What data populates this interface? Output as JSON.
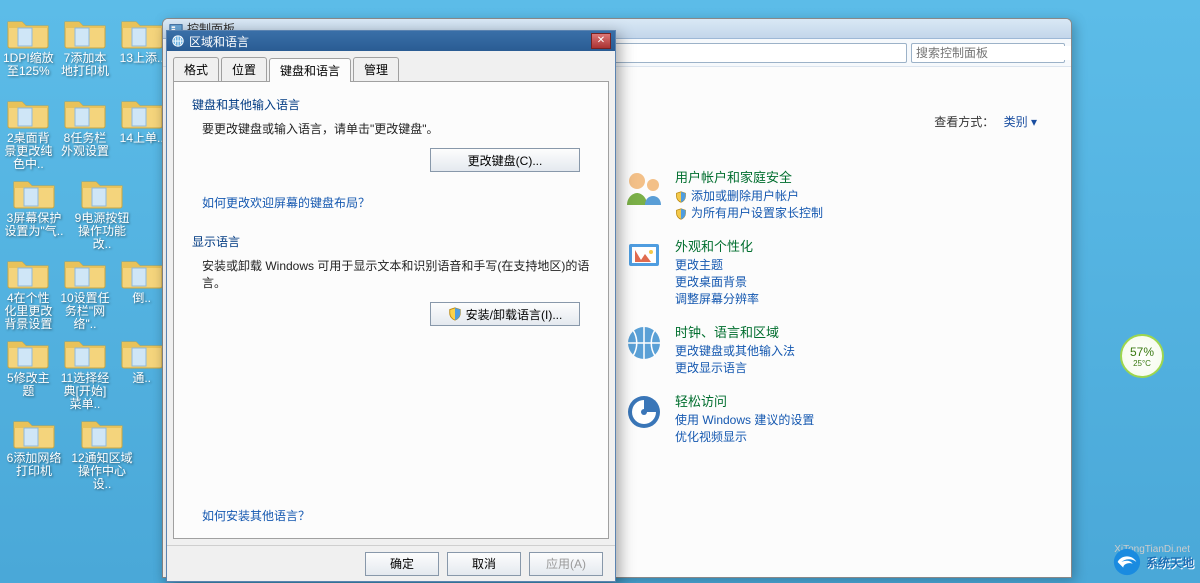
{
  "desktop_icons": [
    [
      "1DPI缩放至125%",
      "7添加本地打印机",
      "13上添.."
    ],
    [
      "2桌面背景更改纯色中..",
      "8任务栏外观设置",
      "14上单.."
    ],
    [
      "3屏幕保护设置为\"气..",
      "9电源按钮操作功能改.."
    ],
    [
      "4在个性化里更改背景设置",
      "10设置任务栏\"网络\"..",
      "倒.."
    ],
    [
      "5修改主题",
      "11选择经典[开始]菜单..",
      "通.."
    ],
    [
      "6添加网络打印机",
      "12通知区域操作中心设.."
    ]
  ],
  "cp": {
    "title": "控制面板",
    "search_placeholder": "搜索控制面板",
    "viewmode_label": "查看方式：",
    "viewmode_value": "类别",
    "cats": [
      {
        "title": "用户帐户和家庭安全",
        "links": [
          "添加或删除用户帐户",
          "为所有用户设置家长控制"
        ],
        "shields": [
          true,
          true
        ]
      },
      {
        "title": "外观和个性化",
        "links": [
          "更改主题",
          "更改桌面背景",
          "调整屏幕分辨率"
        ]
      },
      {
        "title": "时钟、语言和区域",
        "links": [
          "更改键盘或其他输入法",
          "更改显示语言"
        ]
      },
      {
        "title": "轻松访问",
        "links": [
          "使用 Windows 建议的设置",
          "优化视频显示"
        ]
      }
    ]
  },
  "dlg": {
    "title": "区域和语言",
    "tabs": [
      "格式",
      "位置",
      "键盘和语言",
      "管理"
    ],
    "active_tab": 2,
    "group1_title": "键盘和其他输入语言",
    "group1_text": "要更改键盘或输入语言，请单击\"更改键盘\"。",
    "btn_change_keyboard": "更改键盘(C)...",
    "link1": "如何更改欢迎屏幕的键盘布局？",
    "group2_title": "显示语言",
    "group2_text": "安装或卸载 Windows 可用于显示文本和识别语音和手写(在支持地区)的语言。",
    "btn_install_lang": "安装/卸载语言(I)...",
    "link2": "如何安装其他语言？",
    "ok": "确定",
    "cancel": "取消",
    "apply": "应用(A)"
  },
  "widget": {
    "pct": "57%",
    "temp": "25°C"
  },
  "watermark": {
    "brand": "系统天地",
    "url": "XiTongTianDi.net"
  }
}
